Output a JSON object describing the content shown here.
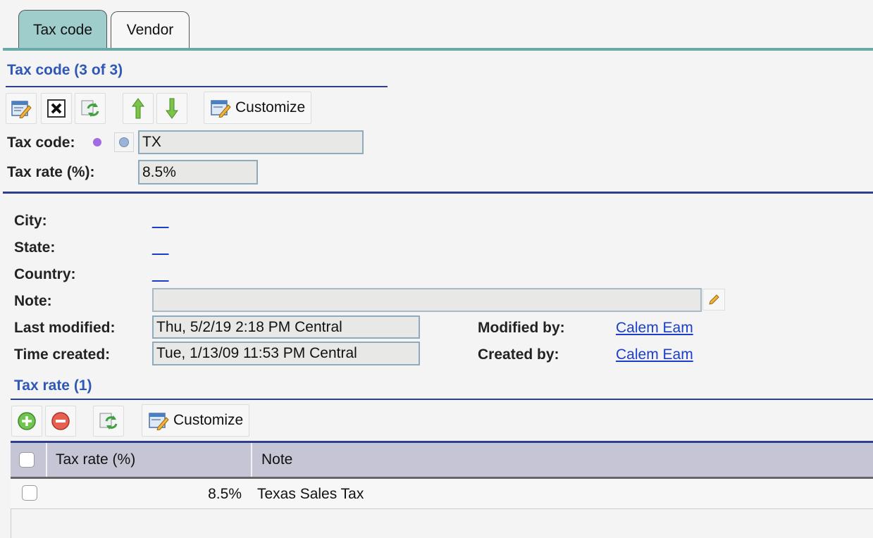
{
  "tabs": [
    {
      "label": "Tax code",
      "active": true
    },
    {
      "label": "Vendor",
      "active": false
    }
  ],
  "header": {
    "title": "Tax code (3 of 3)",
    "toolbar": {
      "customize_label": "Customize"
    }
  },
  "fields": {
    "tax_code": {
      "label": "Tax code:",
      "value": "TX"
    },
    "tax_rate": {
      "label": "Tax rate (%):",
      "value": "8.5%"
    }
  },
  "details": {
    "city": {
      "label": "City:",
      "value": "__"
    },
    "state": {
      "label": "State:",
      "value": "__"
    },
    "country": {
      "label": "Country:",
      "value": "__"
    },
    "note": {
      "label": "Note:",
      "value": ""
    },
    "last_modified": {
      "label": "Last modified:",
      "value": "Thu, 5/2/19 2:18 PM Central"
    },
    "time_created": {
      "label": "Time created:",
      "value": "Tue, 1/13/09 11:53 PM Central"
    },
    "modified_by": {
      "label": "Modified by:",
      "value": "Calem Eam"
    },
    "created_by": {
      "label": "Created by:",
      "value": "Calem Eam"
    }
  },
  "tax_rate_section": {
    "title": "Tax rate (1)",
    "customize_label": "Customize",
    "columns": [
      "Tax rate (%)",
      "Note"
    ],
    "rows": [
      {
        "rate": "8.5%",
        "note": "Texas Sales Tax"
      }
    ]
  },
  "colors": {
    "accent": "#2f57b7",
    "tab_active": "#9fcdcb",
    "link": "#1a3ec8"
  }
}
